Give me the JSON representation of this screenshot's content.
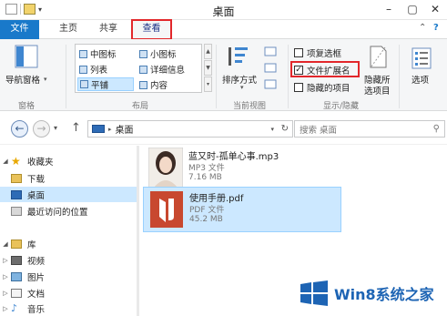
{
  "window": {
    "title": "桌面"
  },
  "ribbon_tabs": [
    {
      "label": "文件"
    },
    {
      "label": "主页"
    },
    {
      "label": "共享"
    },
    {
      "label": "查看"
    }
  ],
  "ribbon": {
    "pane": {
      "nav_pane_label": "导航窗格",
      "group_label": "窗格"
    },
    "layout": {
      "items": [
        "中图标",
        "小图标",
        "列表",
        "详细信息",
        "平铺",
        "内容"
      ],
      "group_label": "布局"
    },
    "current_view": {
      "sort_label": "排序方式",
      "group_label": "当前视图"
    },
    "show_hide": {
      "item_checkboxes": "项复选框",
      "file_extensions": "文件扩展名",
      "hidden_items": "隐藏的项目",
      "hide_selected_line1": "隐藏所",
      "hide_selected_line2": "选项目",
      "group_label": "显示/隐藏"
    },
    "options_label": "选项"
  },
  "address": {
    "path": "桌面"
  },
  "search": {
    "placeholder": "搜索 桌面"
  },
  "nav_pane": {
    "favorites_header": "收藏夹",
    "favorites": [
      "下载",
      "桌面",
      "最近访问的位置"
    ],
    "library_header": "库",
    "library": [
      "视频",
      "图片",
      "文档",
      "音乐"
    ]
  },
  "files": [
    {
      "name": "蓝又时-孤单心事.mp3",
      "type": "MP3 文件",
      "size": "7.16 MB"
    },
    {
      "name": "使用手册.pdf",
      "type": "PDF 文件",
      "size": "45.2 MB"
    }
  ],
  "watermark": {
    "text": "Win8系统之家"
  },
  "colors": {
    "file_tab": "#1979ca",
    "highlight": "#e2272b",
    "selection": "#cce8ff"
  }
}
